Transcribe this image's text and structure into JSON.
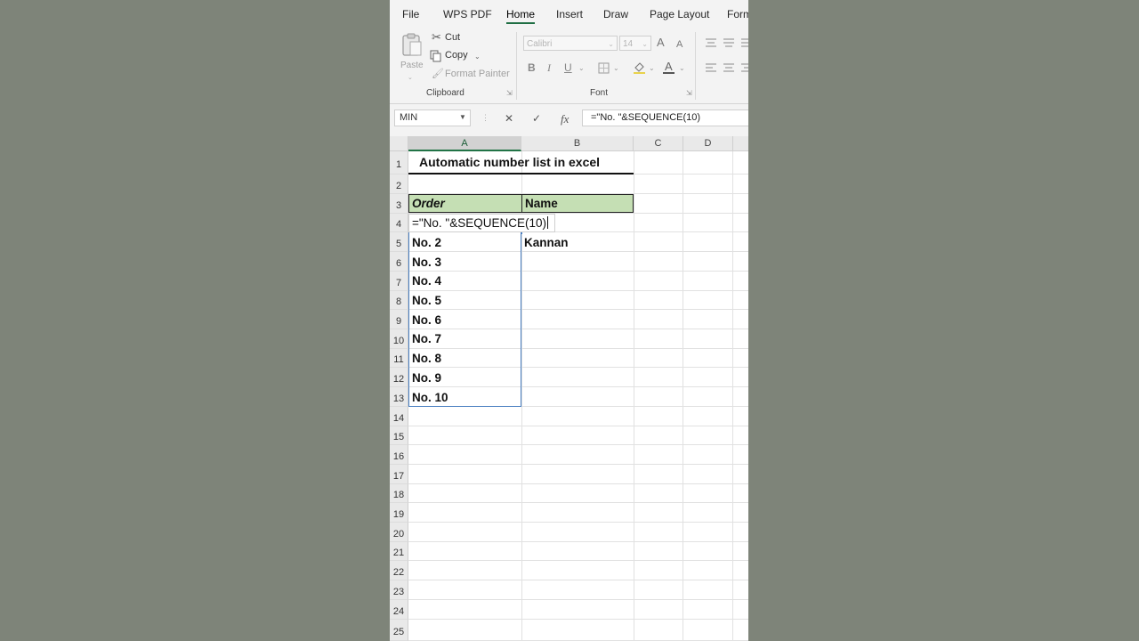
{
  "menu": {
    "items": [
      "File",
      "WPS PDF",
      "Home",
      "Insert",
      "Draw",
      "Page Layout",
      "Form"
    ],
    "active": "Home"
  },
  "ribbon": {
    "clipboard": {
      "paste_label": "Paste",
      "cut_label": "Cut",
      "copy_label": "Copy",
      "format_painter_label": "Format Painter",
      "group_label": "Clipboard"
    },
    "font": {
      "font_name": "Calibri",
      "font_size": "14",
      "bold": "B",
      "italic": "I",
      "underline": "U",
      "grow": "A",
      "shrink": "A",
      "font_color": "A",
      "group_label": "Font"
    }
  },
  "formula_bar": {
    "name_box": "MIN",
    "cancel_icon": "✕",
    "enter_icon": "✓",
    "fx_label": "fx",
    "formula": "=\"No. \"&SEQUENCE(10)"
  },
  "sheet": {
    "columns": [
      "A",
      "B",
      "C",
      "D"
    ],
    "selected_column": "A",
    "rows": [
      "1",
      "2",
      "3",
      "4",
      "5",
      "6",
      "7",
      "8",
      "9",
      "10",
      "11",
      "12",
      "13",
      "14",
      "15",
      "16",
      "17",
      "18",
      "19",
      "20",
      "21",
      "22",
      "23",
      "24",
      "25"
    ],
    "title": "Automatic number list in excel",
    "header_order": "Order",
    "header_name": "Name",
    "active_cell_text": "=\"No. \"&SEQUENCE(10)",
    "column_a_values": [
      "No. 2",
      "No. 3",
      "No. 4",
      "No. 5",
      "No. 6",
      "No. 7",
      "No. 8",
      "No. 9",
      "No. 10"
    ],
    "b5_value": "Kannan"
  },
  "colors": {
    "accent": "#217346",
    "header_fill": "#c5dfb4",
    "spill_border": "#4a7fc1",
    "background": "#7e8479"
  }
}
